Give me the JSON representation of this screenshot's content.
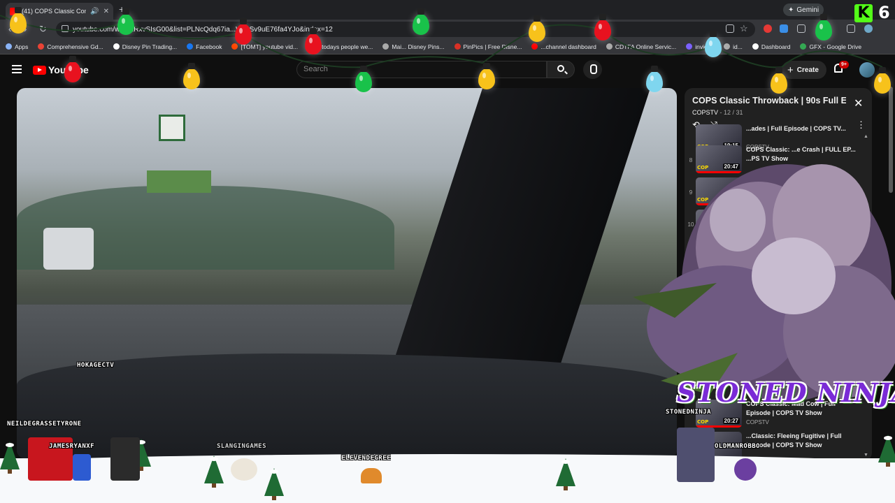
{
  "browser": {
    "tab_title": "(41) COPS Classic Comfort",
    "new_tab": "+",
    "gemini_label": "Gemini",
    "url": "youtube.com/w...X2RxvSIsG00&list=PLNcQdq67ia...WiIsSv9uE76fa4YJo&index=12",
    "bookmarks": [
      {
        "label": "Apps",
        "color": "#8ab4f8"
      },
      {
        "label": "Comprehensive Gd...",
        "color": "#ea4335"
      },
      {
        "label": "Disney Pin Trading...",
        "color": "#ffffff"
      },
      {
        "label": "Facebook",
        "color": "#1877f2"
      },
      {
        "label": "[TOMT] youtube vid...",
        "color": "#ff4500"
      },
      {
        "label": "If todays people we...",
        "color": "#ff4500"
      },
      {
        "label": "Mai... Disney Pins...",
        "color": "#aaaaaa"
      },
      {
        "label": "PinPics | Free Disne...",
        "color": "#d93025"
      },
      {
        "label": "...channel dashboard",
        "color": "#ff0000"
      },
      {
        "label": "CDTFA Online Servic...",
        "color": "#aaaaaa"
      },
      {
        "label": "invideo",
        "color": "#7b61ff"
      },
      {
        "label": "id...",
        "color": "#aaaaaa"
      },
      {
        "label": "Dashboard",
        "color": "#ffffff"
      },
      {
        "label": "GFX - Google Drive",
        "color": "#34a853"
      }
    ]
  },
  "youtube": {
    "logo_text": "YouTube",
    "search_placeholder": "Search",
    "create_label": "Create",
    "notification_badge": "9+"
  },
  "video": {
    "overlay_labels": [
      "HOKAGECTV",
      "NEILDEGRASSETYRONE",
      "JAMESRYANXF",
      "SLANGINGAMES",
      "ELEVENDEGREE",
      "STONEDNINJA",
      "OLDMANROBBO"
    ]
  },
  "playlist": {
    "title": "COPS Classic Throwback | 90s Full E...",
    "channel": "COPSTV",
    "position": "12 / 31",
    "items": [
      {
        "index": "",
        "title": "...ades | Full Episode | COPS TV...",
        "channel": "COPSTV",
        "duration": "19:15"
      },
      {
        "index": "8",
        "title": "COPS Classic: ...e Crash | FULL EP... ...PS TV Show",
        "channel": "",
        "duration": "20:47"
      },
      {
        "index": "9",
        "title": "",
        "channel": "",
        "duration": "20:37"
      },
      {
        "index": "10",
        "title": "",
        "channel": "",
        "duration": "20:42"
      },
      {
        "index": "",
        "title": "COPS Classic: Mad Cow | Full Episode | COPS TV Show",
        "channel": "COPSTV",
        "duration": "20:27"
      },
      {
        "index": "",
        "title": "...Classic: Fleeing Fugitive | Full Episode | COPS TV Show",
        "channel": "",
        "duration": ""
      }
    ]
  },
  "overlay": {
    "banner_text": "STONED NINJA",
    "logo_letter": "K",
    "logo_number": "6"
  },
  "colors": {
    "yt_red": "#ff0000",
    "bulb_red": "#e8121f",
    "bulb_green": "#19c24a",
    "bulb_yellow": "#f7c21b",
    "bulb_blue": "#7fd6ef"
  }
}
